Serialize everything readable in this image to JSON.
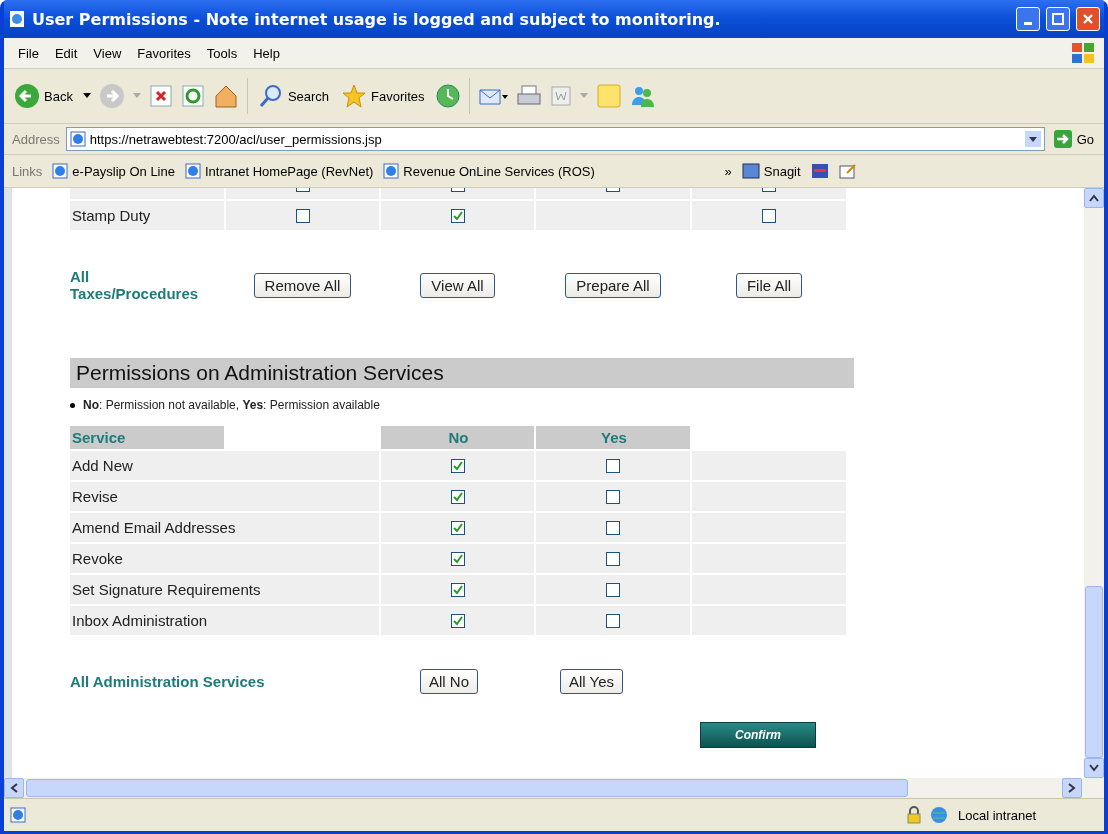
{
  "window": {
    "title": "User Permissions - Note internet usage is logged and subject to monitoring."
  },
  "menu": [
    "File",
    "Edit",
    "View",
    "Favorites",
    "Tools",
    "Help"
  ],
  "toolbar": {
    "back": "Back",
    "search": "Search",
    "favorites": "Favorites"
  },
  "address": {
    "label": "Address",
    "url": "https://netrawebtest:7200/acl/user_permissions.jsp",
    "go": "Go"
  },
  "links": {
    "label": "Links",
    "items": [
      "e-Payslip On Line",
      "Intranet HomePage (RevNet)",
      "Revenue OnLine Services (ROS)"
    ],
    "chevron": "»",
    "snagit": "Snagit"
  },
  "tax_rows": [
    {
      "cells": [
        {
          "kind": "checkbox",
          "checked": false
        },
        {
          "kind": "checkbox",
          "checked": false
        },
        {
          "kind": "checkbox",
          "checked": false
        },
        {
          "kind": "checkbox",
          "checked": false
        }
      ]
    },
    {
      "label": "Stamp Duty",
      "cells": [
        {
          "kind": "checkbox",
          "checked": false
        },
        {
          "kind": "checkbox",
          "checked": true
        },
        {
          "kind": "empty"
        },
        {
          "kind": "checkbox",
          "checked": false
        }
      ]
    }
  ],
  "tax_actions": {
    "label": "All Taxes/Procedures",
    "buttons": [
      "Remove All",
      "View All",
      "Prepare All",
      "File All"
    ]
  },
  "admin": {
    "heading": "Permissions on Administration Services",
    "legend": "**No**: Permission not available, **Yes**: Permission available",
    "columns": [
      "Service",
      "No",
      "Yes"
    ],
    "rows": [
      {
        "service": "Add New",
        "no": true,
        "yes": false
      },
      {
        "service": "Revise",
        "no": true,
        "yes": false
      },
      {
        "service": "Amend Email Addresses",
        "no": true,
        "yes": false
      },
      {
        "service": "Revoke",
        "no": true,
        "yes": false
      },
      {
        "service": "Set Signature Requirements",
        "no": true,
        "yes": false
      },
      {
        "service": "Inbox Administration",
        "no": true,
        "yes": false
      }
    ],
    "all_label": "All Administration Services",
    "buttons": [
      "All No",
      "All Yes"
    ],
    "confirm": "Confirm"
  },
  "status": {
    "zone": "Local intranet"
  }
}
